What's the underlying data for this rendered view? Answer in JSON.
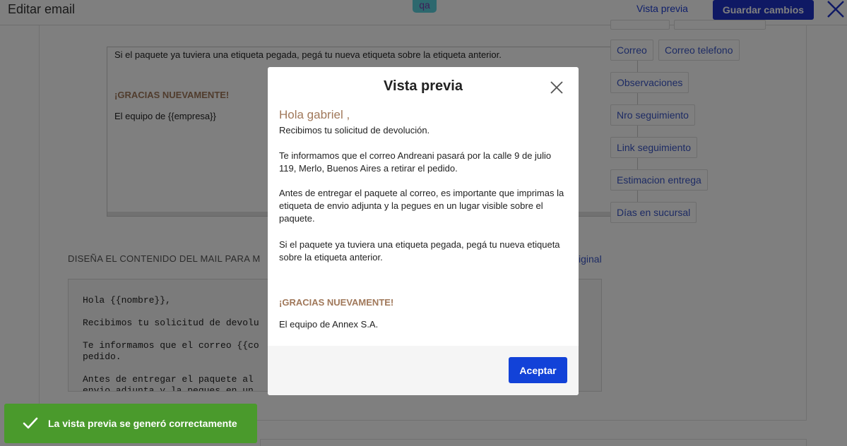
{
  "header": {
    "title": "Editar email",
    "badge": "qa",
    "preview_link": "Vista previa",
    "save_label": "Guardar cambios"
  },
  "editor_top": {
    "lines": [
      "Si el paquete ya tuviera una etiqueta pegada, pegá tu nueva etiqueta sobre la etiqueta anterior.",
      "¡GRACIAS NUEVAMENTE!",
      "El equipo de {{empresa}}"
    ]
  },
  "design_section": {
    "label": "DISEÑA EL CONTENIDO DEL MAIL PARA M",
    "restore_link": "iginal"
  },
  "code_editor": {
    "lines": [
      "Hola {{nombre}},",
      "Recibimos tu solicitud de devolu",
      "Te informamos que el correo {{co",
      "pedido.",
      "Antes de entregar el paquete al",
      "envio adjunta y la pegues en un"
    ]
  },
  "variables": {
    "items": [
      "Correo",
      "Correo telefono",
      "Observaciones",
      "Nro seguimiento",
      "Link seguimiento",
      "Estimacion entrega",
      "Días en sucursal"
    ]
  },
  "modal": {
    "title": "Vista previa",
    "greeting": "Hola gabriel ,",
    "p1": "Recibimos tu solicitud de devolución.",
    "p2": "Te informamos que el correo Andreani pasará por la calle 9 de julio 119, Merlo, Buenos Aires a retirar el pedido.",
    "p3": "Antes de entregar el paquete al correo, es importante que imprimas la etiqueta de envio adjunta y la pegues en un lugar visible sobre el paquete.",
    "p4": "Si el paquete ya tuviera una etiqueta pegada, pegá tu nueva etiqueta sobre la etiqueta anterior.",
    "thanks": "¡GRACIAS NUEVAMENTE!",
    "signoff": "El equipo de Annex S.A.",
    "accept_label": "Aceptar"
  },
  "toast": {
    "message": "La vista previa se generó correctamente"
  },
  "icons": {
    "close": "close-icon",
    "check": "check-icon"
  },
  "colors": {
    "primary": "#1e33c8",
    "accent_text": "#a0785a",
    "link": "#3a56c8",
    "toast": "#4a9a2c"
  }
}
